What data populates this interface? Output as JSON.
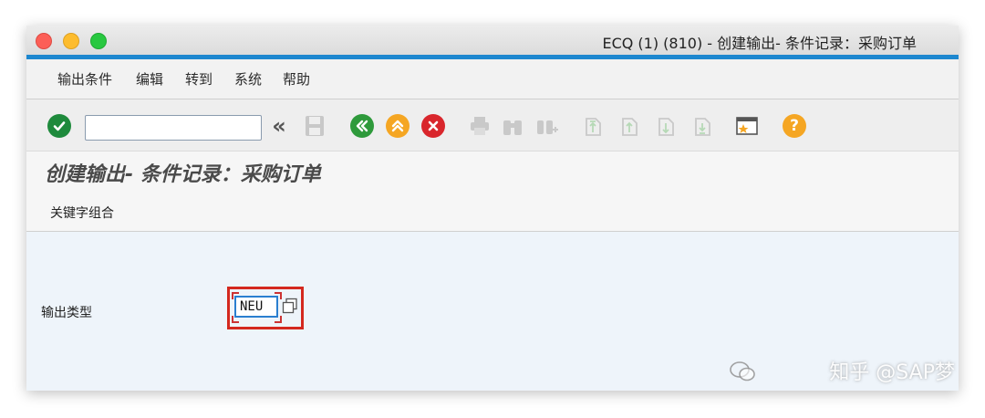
{
  "window": {
    "title": "ECQ (1) (810) - 创建输出- 条件记录：采购订单"
  },
  "menu": {
    "items": [
      "输出条件",
      "编辑",
      "转到",
      "系统",
      "帮助"
    ]
  },
  "toolbar": {
    "command_value": "",
    "back_glyph": "«"
  },
  "page": {
    "title": "创建输出- 条件记录：采购订单",
    "section_label": "关键字组合"
  },
  "form": {
    "output_type_label": "输出类型",
    "output_type_value": "NEU"
  },
  "watermark": {
    "text": "知乎 @SAP梦"
  },
  "colors": {
    "accent": "#1d87cf",
    "highlight": "#d4281e",
    "ok_green": "#1e8a3c",
    "nav_green": "#2e9a3b",
    "nav_orange": "#f5a623",
    "cancel_red": "#d9262c"
  }
}
